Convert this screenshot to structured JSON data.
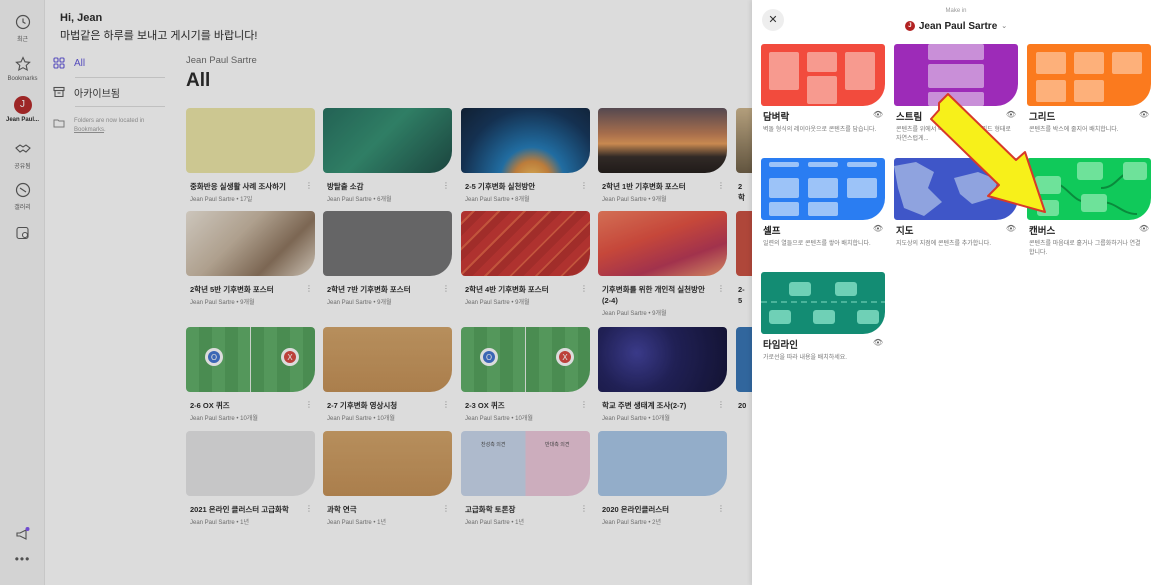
{
  "rail": {
    "recent_label": "최근",
    "bookmarks_label": "Bookmarks",
    "avatar_letter": "J",
    "user_label": "Jean Paul...",
    "shared_label": "공유됨",
    "gallery_label": "갤러리"
  },
  "greeting": {
    "line1": "Hi, Jean",
    "line2": "마법같은 하루를 보내고 게시기를 바랍니다!"
  },
  "sidenav": {
    "all_label": "All",
    "archive_label": "아카이브됨",
    "folder_note_prefix": "Folders are now located in",
    "folder_note_link": "Bookmarks",
    "folder_note_suffix": "."
  },
  "main": {
    "owner": "Jean Paul Sartre",
    "title": "All",
    "cards": [
      {
        "title": "중화반응 실생활 사례 조사하기",
        "meta": "Jean Paul Sartre • 17일"
      },
      {
        "title": "방탈출 소감",
        "meta": "Jean Paul Sartre • 6개월"
      },
      {
        "title": "2-5 기후변화 실천방안",
        "meta": "Jean Paul Sartre • 8개월"
      },
      {
        "title": "2학년 1반 기후변화 포스터",
        "meta": "Jean Paul Sartre • 9개월"
      },
      {
        "title": "2학",
        "meta": ""
      },
      {
        "title": "2학년 5반 기후변화 포스터",
        "meta": "Jean Paul Sartre • 9개월"
      },
      {
        "title": "2학년 7반 기후변화 포스터",
        "meta": "Jean Paul Sartre • 9개월"
      },
      {
        "title": "2학년 4반 기후변화 포스터",
        "meta": "Jean Paul Sartre • 9개월"
      },
      {
        "title": "기후변화를 위한 개인적 실천방안(2-4)",
        "meta": "Jean Paul Sartre • 9개월"
      },
      {
        "title": "2-5",
        "meta": ""
      },
      {
        "title": "2-6 OX 퀴즈",
        "meta": "Jean Paul Sartre • 10개월"
      },
      {
        "title": "2-7 기후변화 영상시청",
        "meta": "Jean Paul Sartre • 10개월"
      },
      {
        "title": "2-3 OX 퀴즈",
        "meta": "Jean Paul Sartre • 10개월"
      },
      {
        "title": "학교 주변 생태계 조사(2-7)",
        "meta": "Jean Paul Sartre • 10개월"
      },
      {
        "title": "20",
        "meta": ""
      },
      {
        "title": "2021 온라인 클러스터 고급화학",
        "meta": "Jean Paul Sartre • 1년"
      },
      {
        "title": "과학 연극",
        "meta": "Jean Paul Sartre • 1년"
      },
      {
        "title": "고급화학 토론장",
        "meta": "Jean Paul Sartre • 1년"
      },
      {
        "title": "2020 온라인클러스터",
        "meta": "Jean Paul Sartre • 2년"
      }
    ],
    "debate_thumb_left": "찬성측 의견",
    "debate_thumb_right": "반대측 의견"
  },
  "panel": {
    "make_in_label": "Make in",
    "make_in_owner": "Jean Paul Sartre",
    "formats": [
      {
        "name": "담벼락",
        "desc": "벽돌 형식의 레이아웃으로 콘텐츠를 담습니다."
      },
      {
        "name": "스트림",
        "desc": "콘텐츠를 위에서 아래로 읽기 쉬운 피드 형태로 자연스럽게..."
      },
      {
        "name": "그리드",
        "desc": "콘텐츠를 박스에 줄지어 배치합니다."
      },
      {
        "name": "셀프",
        "desc": "일련의 열들으로 콘텐츠를 쌓아 배치합니다."
      },
      {
        "name": "지도",
        "desc": "지도상의 지점에 콘텐츠를 추가합니다."
      },
      {
        "name": "캔버스",
        "desc": "콘텐츠를 마음대로 흩거나 그룹화하거나 연결합니다."
      },
      {
        "name": "타임라인",
        "desc": "가로선을 따라 내용을 배치하세요."
      }
    ]
  },
  "colors": {
    "accent": "#5b4fd8",
    "wall": "#f24b3d",
    "stream": "#9d2bb8",
    "grid": "#fb7a1e",
    "shelf": "#2a7df2",
    "map": "#3f56c8",
    "canvas": "#10c95a",
    "timeline": "#138c73",
    "arrow": "#f7f01a"
  }
}
